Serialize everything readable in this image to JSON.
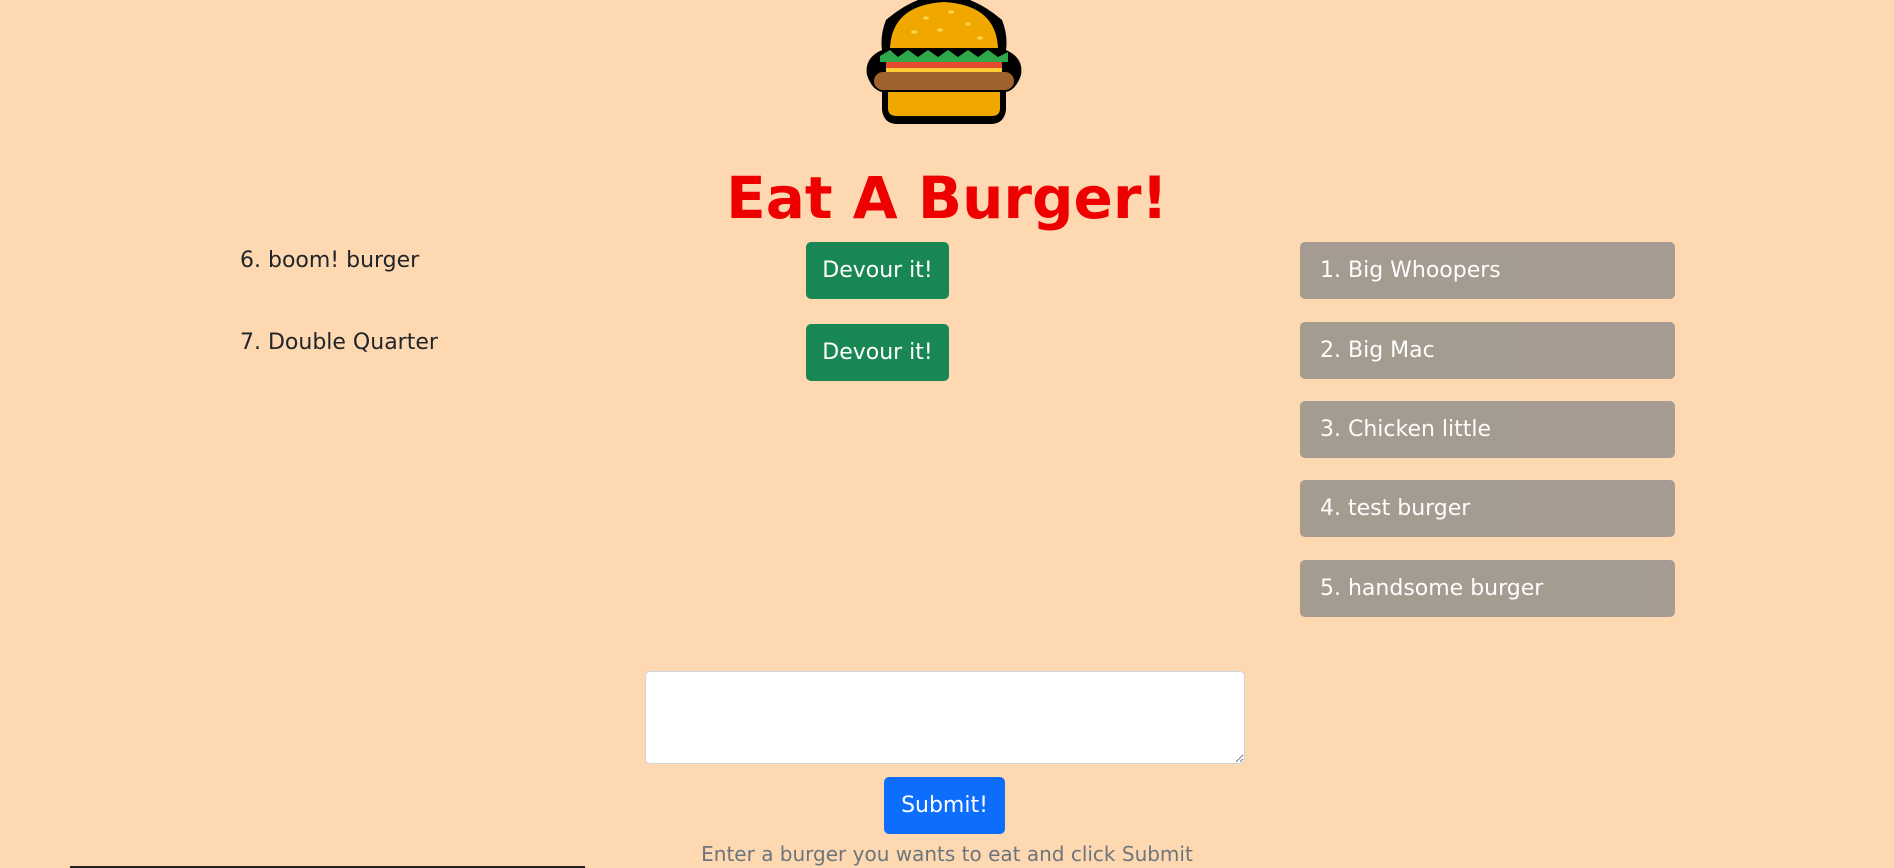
{
  "header": {
    "logo_icon": "burger-icon",
    "title": "Eat A Burger!"
  },
  "uneaten": [
    {
      "label": "6. boom! burger",
      "button_label": "Devour it!"
    },
    {
      "label": "7. Double Quarter",
      "button_label": "Devour it!"
    }
  ],
  "eaten": [
    {
      "label": "1. Big Whoopers"
    },
    {
      "label": "2. Big Mac"
    },
    {
      "label": "3. Chicken little"
    },
    {
      "label": "4. test burger"
    },
    {
      "label": "5. handsome burger"
    }
  ],
  "form": {
    "input_value": "",
    "submit_label": "Submit!",
    "helper_text": "Enter a burger you wants to eat and click Submit"
  },
  "colors": {
    "background": "#fed8b1",
    "title": "#ee0000",
    "devour_button": "#198754",
    "eaten_item": "#a09890",
    "submit_button": "#0d6efd"
  }
}
